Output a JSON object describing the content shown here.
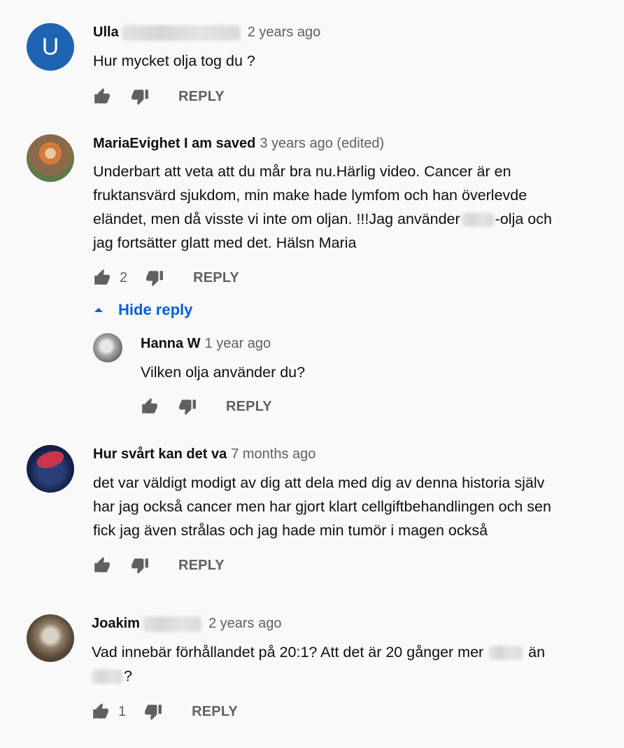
{
  "comments": [
    {
      "author": "Ulla",
      "time": "2 years ago",
      "avatar_letter": "U",
      "lines": [
        "Hur mycket olja tog du ?"
      ],
      "likes": "",
      "reply_label": "REPLY"
    },
    {
      "author": "MariaEvighet I am saved",
      "time": "3 years ago (edited)",
      "lines": [
        "Underbart att veta att du mår bra nu.Härlig video. Cancer är en",
        "fruktansvärd sjukdom, min make hade lymfom och han överlevde",
        "eländet, men då visste vi inte  om oljan. !!!Jag använder",
        "-olja och",
        "jag fortsätter glatt med det. Hälsn Maria"
      ],
      "likes": "2",
      "reply_label": "REPLY",
      "hide_reply_label": "Hide reply",
      "reply": {
        "author": "Hanna W",
        "time": "1 year ago",
        "lines": [
          "Vilken olja använder du?"
        ],
        "reply_label": "REPLY"
      }
    },
    {
      "author": "Hur svårt kan det va",
      "time": "7 months ago",
      "lines": [
        "det var väldigt modigt av dig att dela med dig av denna historia själv",
        "har jag också cancer men har gjort klart cellgiftbehandlingen och sen",
        "fick jag även strålas och jag hade min tumör i magen också"
      ],
      "likes": "",
      "reply_label": "REPLY"
    },
    {
      "author": "Joakim",
      "time": "2 years ago",
      "lines": [
        "Vad innebär förhållandet på 20:1? Att det är 20 gånger mer",
        "än",
        "?"
      ],
      "likes": "1",
      "reply_label": "REPLY"
    }
  ],
  "colors": {
    "background": "#f9f9f9",
    "avatar_letter_bg": "#1e64b3",
    "link_blue": "#065fd4",
    "secondary_text": "#606060"
  }
}
